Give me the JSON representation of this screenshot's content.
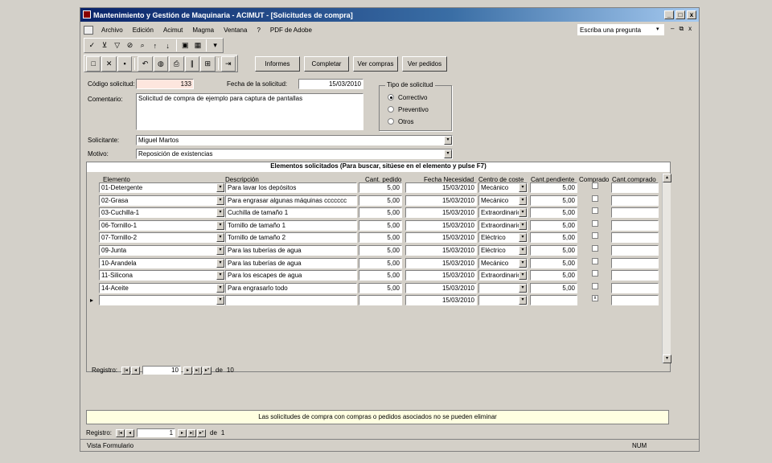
{
  "window": {
    "title": "Mantenimiento y Gestión de Maquinaria - ACIMUT - [Solicitudes de compra]",
    "btn_min": "_",
    "btn_max": "□",
    "btn_close": "x"
  },
  "menu": [
    "Archivo",
    "Edición",
    "Acimut",
    "Magma",
    "Ventana",
    "?",
    "PDF de Adobe"
  ],
  "ask": {
    "text": "Escriba una pregunta",
    "arrow": "▾"
  },
  "docctl": {
    "min": "–",
    "restore": "⧉",
    "close": "x"
  },
  "buttons": {
    "informes": "Informes",
    "completar": "Completar",
    "ver_compras": "Ver compras",
    "ver_pedidos": "Ver pedidos"
  },
  "form": {
    "codigo_label": "Código solicitud:",
    "codigo_value": "133",
    "fecha_label": "Fecha de la solicitud:",
    "fecha_value": "15/03/2010",
    "comentario_label": "Comentario:",
    "comentario_value": "Solicitud de compra de ejemplo para captura de pantallas",
    "tipo_label": "Tipo de solicitud",
    "tipo_options": [
      "Correctivo",
      "Preventivo",
      "Otros"
    ],
    "tipo_selected": "Correctivo",
    "solicitante_label": "Solicitante:",
    "solicitante_value": "Miguel Martos",
    "motivo_label": "Motivo:",
    "motivo_value": "Reposición de existencias"
  },
  "subform": {
    "title": "Elementos solicitados (Para buscar, sitúese en el elemento y pulse F7)",
    "headers": [
      "Elemento",
      "Descripción",
      "Cant. pedido",
      "Fecha Necesidad",
      "Centro de coste",
      "Cant.pendiente",
      "Comprado",
      "Cant.comprado"
    ],
    "rows": [
      {
        "elemento": "01-Detergente",
        "descripcion": "Para lavar los depósitos",
        "cant": "5,00",
        "fecha": "15/03/2010",
        "centro": "Mecánico",
        "pend": "5,00"
      },
      {
        "elemento": "02-Grasa",
        "descripcion": "Para engrasar algunas máquinas ccccccc",
        "cant": "5,00",
        "fecha": "15/03/2010",
        "centro": "Mecánico",
        "pend": "5,00"
      },
      {
        "elemento": "03-Cuchilla-1",
        "descripcion": "Cuchilla de tamaño 1",
        "cant": "5,00",
        "fecha": "15/03/2010",
        "centro": "Extraordinario",
        "pend": "5,00"
      },
      {
        "elemento": "06-Tornillo-1",
        "descripcion": "Tornillo de tamaño 1",
        "cant": "5,00",
        "fecha": "15/03/2010",
        "centro": "Extraordinario",
        "pend": "5,00"
      },
      {
        "elemento": "07-Tornillo-2",
        "descripcion": "Tornillo de tamaño 2",
        "cant": "5,00",
        "fecha": "15/03/2010",
        "centro": "Eléctrico",
        "pend": "5,00"
      },
      {
        "elemento": "09-Junta",
        "descripcion": "Para las tuberías de agua",
        "cant": "5,00",
        "fecha": "15/03/2010",
        "centro": "Eléctrico",
        "pend": "5,00"
      },
      {
        "elemento": "10-Arandela",
        "descripcion": "Para las tuberías de agua",
        "cant": "5,00",
        "fecha": "15/03/2010",
        "centro": "Mecánico",
        "pend": "5,00"
      },
      {
        "elemento": "11-Silicona",
        "descripcion": "Para los escapes de agua",
        "cant": "5,00",
        "fecha": "15/03/2010",
        "centro": "Extraordinario",
        "pend": "5,00"
      },
      {
        "elemento": "14-Aceite",
        "descripcion": "Para engrasarlo todo",
        "cant": "5,00",
        "fecha": "15/03/2010",
        "centro": "",
        "pend": "5,00"
      }
    ],
    "newrow": {
      "fecha": "15/03/2010",
      "comprado_mark": "x"
    },
    "nav": {
      "label": "Registro:",
      "current": "10",
      "of": "de",
      "total": "10"
    }
  },
  "notice": "Las solicitudes de compra con compras o pedidos asociados no se pueden eliminar",
  "mainnav": {
    "label": "Registro:",
    "current": "1",
    "of": "de",
    "total": "1"
  },
  "status": {
    "left": "Vista Formulario",
    "right": "NUM"
  },
  "icons": {
    "nav_first": "|◂",
    "nav_prev": "◂",
    "nav_next": "▸",
    "nav_last": "▸|",
    "nav_new": "▸*",
    "dd": "▾",
    "up": "▴",
    "down": "▾",
    "row_pointer": "▸"
  }
}
